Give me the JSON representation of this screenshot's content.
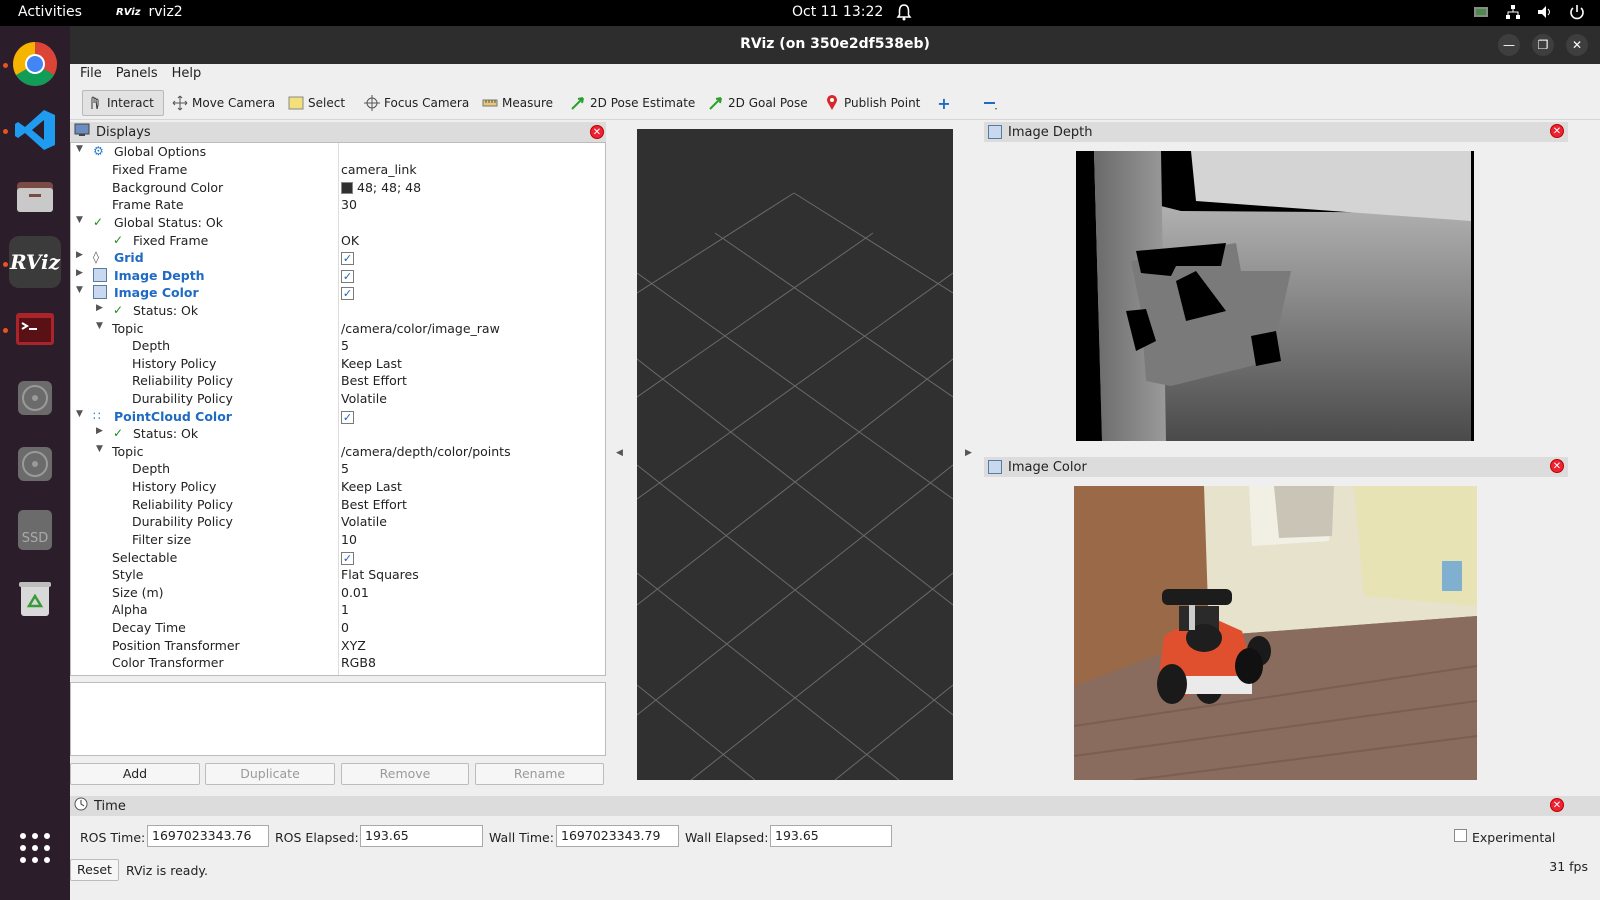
{
  "topbar": {
    "activities": "Activities",
    "app_name": "rviz2",
    "app_icon_text": "RViz",
    "datetime": "Oct 11  13:22"
  },
  "dock": {
    "rviz_label": "RViz",
    "ssd_label": "SSD"
  },
  "window": {
    "title": "RViz (on 350e2df538eb)"
  },
  "menu": [
    "File",
    "Panels",
    "Help"
  ],
  "toolbar": {
    "interact": "Interact",
    "move_camera": "Move Camera",
    "select": "Select",
    "focus_camera": "Focus Camera",
    "measure": "Measure",
    "pose_estimate": "2D Pose Estimate",
    "goal_pose": "2D Goal Pose",
    "publish_point": "Publish Point"
  },
  "displays": {
    "title": "Displays",
    "rows": {
      "global_options": "Global Options",
      "fixed_frame": "Fixed Frame",
      "fixed_frame_val": "camera_link",
      "bg_color": "Background Color",
      "bg_color_val": "48; 48; 48",
      "frame_rate": "Frame Rate",
      "frame_rate_val": "30",
      "global_status": "Global Status: Ok",
      "fixed_frame_status": "Fixed Frame",
      "fixed_frame_status_val": "OK",
      "grid": "Grid",
      "image_depth": "Image Depth",
      "image_color": "Image Color",
      "ic_status": "Status: Ok",
      "ic_topic": "Topic",
      "ic_topic_val": "/camera/color/image_raw",
      "ic_depth": "Depth",
      "ic_depth_val": "5",
      "ic_history": "History Policy",
      "ic_history_val": "Keep Last",
      "ic_reliability": "Reliability Policy",
      "ic_reliability_val": "Best Effort",
      "ic_durability": "Durability Policy",
      "ic_durability_val": "Volatile",
      "pointcloud": "PointCloud Color",
      "pc_status": "Status: Ok",
      "pc_topic": "Topic",
      "pc_topic_val": "/camera/depth/color/points",
      "pc_depth": "Depth",
      "pc_depth_val": "5",
      "pc_history": "History Policy",
      "pc_history_val": "Keep Last",
      "pc_reliability": "Reliability Policy",
      "pc_reliability_val": "Best Effort",
      "pc_durability": "Durability Policy",
      "pc_durability_val": "Volatile",
      "pc_filter": "Filter size",
      "pc_filter_val": "10",
      "selectable": "Selectable",
      "style": "Style",
      "style_val": "Flat Squares",
      "size": "Size (m)",
      "size_val": "0.01",
      "alpha": "Alpha",
      "alpha_val": "1",
      "decay": "Decay Time",
      "decay_val": "0",
      "pos_transformer": "Position Transformer",
      "pos_transformer_val": "XYZ",
      "color_transformer": "Color Transformer",
      "color_transformer_val": "RGB8"
    },
    "buttons": {
      "add": "Add",
      "duplicate": "Duplicate",
      "remove": "Remove",
      "rename": "Rename"
    }
  },
  "image_depth_panel": {
    "title": "Image Depth"
  },
  "image_color_panel": {
    "title": "Image Color"
  },
  "time": {
    "title": "Time",
    "ros_time_label": "ROS Time:",
    "ros_time": "1697023343.76",
    "ros_elapsed_label": "ROS Elapsed:",
    "ros_elapsed": "193.65",
    "wall_time_label": "Wall Time:",
    "wall_time": "1697023343.79",
    "wall_elapsed_label": "Wall Elapsed:",
    "wall_elapsed": "193.65",
    "experimental": "Experimental"
  },
  "status": {
    "reset": "Reset",
    "message": "RViz is ready.",
    "fps": "31 fps"
  },
  "colors": {
    "accent": "#e95420",
    "link_blue": "#1f6bc4",
    "view_bg": "#303030"
  }
}
